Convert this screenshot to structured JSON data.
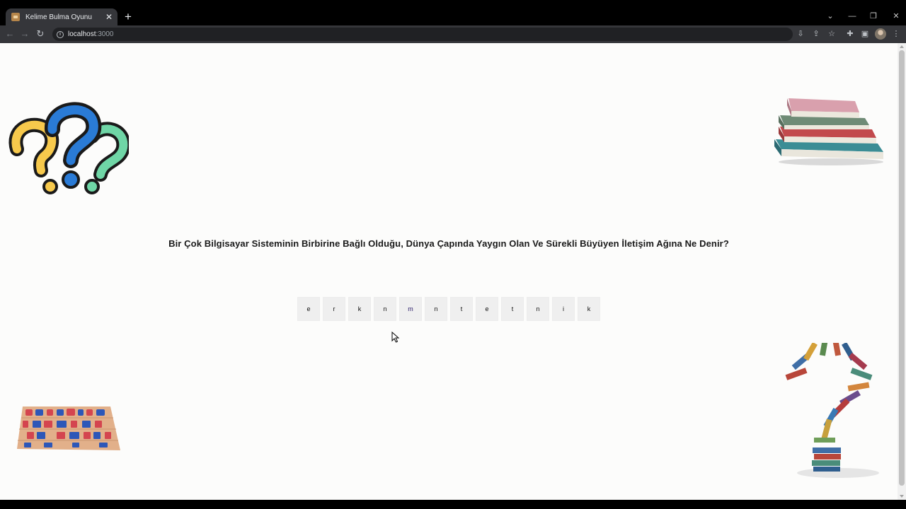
{
  "browser": {
    "tab_title": "Kelime Bulma Oyunu",
    "tab_close": "✕",
    "new_tab": "+",
    "url_host": "localhost",
    "url_port": ":3000"
  },
  "page": {
    "question": "Bir Çok Bilgisayar Sisteminin Birbirine Bağlı Olduğu, Dünya Çapında Yaygın Olan Ve Sürekli Büyüyen İletişim Ağına Ne Denir?",
    "letters": [
      "e",
      "r",
      "k",
      "n",
      "m",
      "n",
      "t",
      "e",
      "t",
      "n",
      "i",
      "k"
    ]
  },
  "colors": {
    "page_background": "#fcfcfb",
    "letter_tile": "#efefef"
  }
}
